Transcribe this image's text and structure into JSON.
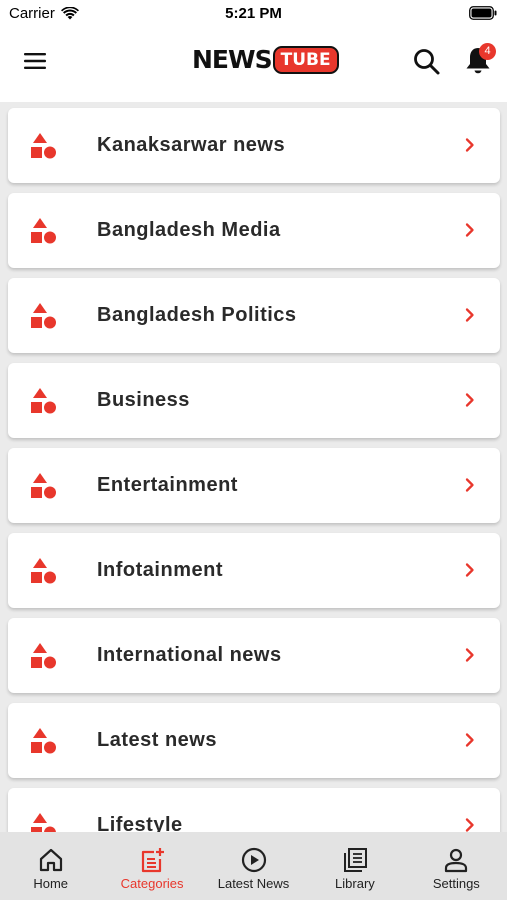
{
  "status_bar": {
    "carrier": "Carrier",
    "time": "5:21 PM"
  },
  "header": {
    "logo_left": "NEWS",
    "logo_right": "TUBE",
    "notification_count": "4"
  },
  "colors": {
    "accent": "#e8372c",
    "card_bg": "#ffffff",
    "list_bg": "#ebebeb",
    "tab_bar_bg": "#e3e3e3"
  },
  "categories": [
    {
      "label": "Kanaksarwar news",
      "icon": "shapes-icon"
    },
    {
      "label": "Bangladesh Media",
      "icon": "shapes-icon"
    },
    {
      "label": "Bangladesh Politics",
      "icon": "shapes-icon"
    },
    {
      "label": "Business",
      "icon": "shapes-icon"
    },
    {
      "label": "Entertainment",
      "icon": "shapes-icon"
    },
    {
      "label": "Infotainment",
      "icon": "shapes-icon"
    },
    {
      "label": "International news",
      "icon": "shapes-icon"
    },
    {
      "label": "Latest news",
      "icon": "shapes-icon"
    },
    {
      "label": "Lifestyle",
      "icon": "shapes-icon"
    }
  ],
  "tabs": [
    {
      "label": "Home",
      "icon": "home-icon",
      "active": false
    },
    {
      "label": "Categories",
      "icon": "categories-icon",
      "active": true
    },
    {
      "label": "Latest News",
      "icon": "play-circle-icon",
      "active": false
    },
    {
      "label": "Library",
      "icon": "library-icon",
      "active": false
    },
    {
      "label": "Settings",
      "icon": "person-icon",
      "active": false
    }
  ]
}
